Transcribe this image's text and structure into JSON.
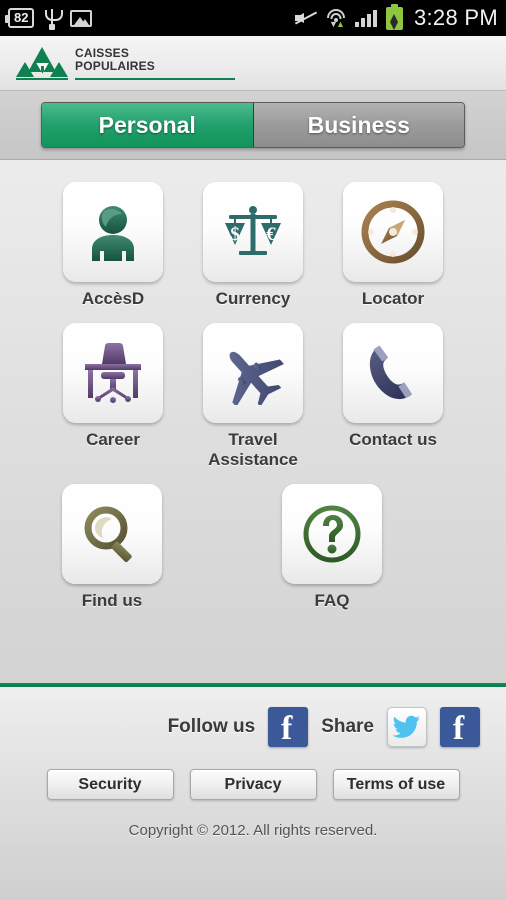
{
  "statusbar": {
    "notification_badge": "82",
    "usb_icon": "usb-icon",
    "image_icon": "image-icon",
    "mute_icon": "mute-icon",
    "wifi_icon": "wifi-icon",
    "signal_icon": "signal-icon",
    "battery_icon": "battery-charging-icon",
    "time": "3:28 PM"
  },
  "header": {
    "logo_line1": "CAISSES",
    "logo_line2": "POPULAIRES",
    "logo_icon": "caisses-populaires-logo"
  },
  "tabs": [
    {
      "label": "Personal",
      "active": true
    },
    {
      "label": "Business",
      "active": false
    }
  ],
  "menu": {
    "rows": [
      [
        {
          "label": "AccèsD",
          "icon": "person-icon",
          "color": "#2c6b57"
        },
        {
          "label": "Currency",
          "icon": "scales-icon",
          "color": "#2b6a6a"
        },
        {
          "label": "Locator",
          "icon": "compass-icon",
          "color": "#8a6a3f"
        }
      ],
      [
        {
          "label": "Career",
          "icon": "desk-chair-icon",
          "color": "#6d5183"
        },
        {
          "label": "Travel\nAssistance",
          "icon": "airplane-icon",
          "color": "#4a5380"
        },
        {
          "label": "Contact us",
          "icon": "phone-icon",
          "color": "#3a3c63"
        }
      ],
      [
        {
          "label": "Find us",
          "icon": "magnifier-icon",
          "color": "#6f6b42"
        },
        {
          "label": "FAQ",
          "icon": "question-mark-icon",
          "color": "#3f7034"
        }
      ]
    ]
  },
  "footer": {
    "follow_label": "Follow us",
    "share_label": "Share",
    "follow_facebook_icon": "facebook-icon",
    "share_twitter_icon": "twitter-icon",
    "share_facebook_icon": "facebook-icon",
    "buttons": [
      {
        "label": "Security"
      },
      {
        "label": "Privacy"
      },
      {
        "label": "Terms of use"
      }
    ],
    "copyright": "Copyright © 2012. All rights reserved."
  },
  "colors": {
    "brand_green": "#0f8050",
    "tab_active_green": "#22a06d",
    "facebook_blue": "#3b5998",
    "twitter_blue": "#4fc2f0"
  }
}
